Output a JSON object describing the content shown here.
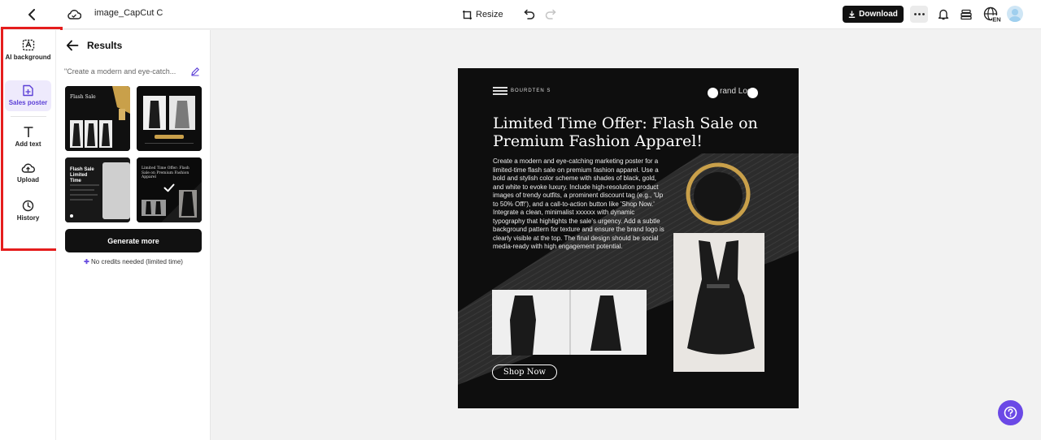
{
  "header": {
    "filename": "image_CapCut C",
    "resize_label": "Resize",
    "download_label": "Download"
  },
  "rail": {
    "items": [
      {
        "label": "AI background",
        "icon": "ai-background-icon"
      },
      {
        "label": "Sales poster",
        "icon": "sales-poster-icon"
      },
      {
        "label": "Add text",
        "icon": "text-icon"
      },
      {
        "label": "Upload",
        "icon": "upload-icon"
      },
      {
        "label": "History",
        "icon": "clock-icon"
      }
    ],
    "active": "Sales poster"
  },
  "results": {
    "title": "Results",
    "prompt": "\"Create a modern and eye-catch...",
    "thumbs": [
      {
        "title": "Flash Sale"
      },
      {
        "title": ""
      },
      {
        "title": "Flash Sale Limited Time"
      },
      {
        "title": "Limited Time Offer: Flash Sale on Premium Fashion Apparel"
      }
    ],
    "selected_index": 3,
    "generate_label": "Generate more",
    "credits_note": "No credits needed (limited time)"
  },
  "poster": {
    "brand": "BOURDTEN S",
    "brand_logo": "rand Log",
    "headline": "Limited Time Offer: Flash Sale on Premium Fashion Apparel!",
    "body": "Create a modern and eye-catching marketing poster for a limited-time flash sale on premium fashion apparel. Use a bold and stylish color scheme with shades of black, gold, and white to evoke luxury. Include high-resolution product images of trendy outfits, a prominent discount tag (e.g., 'Up to 50% Off!'), and a call-to-action button like 'Shop Now.' Integrate a clean, minimalist xxxxxx with dynamic typography that highlights the sale's urgency. Add a subtle background pattern for texture and ensure the brand logo is clearly visible at the top. The final design should be social media-ready with high engagement potential.",
    "cta": "Shop Now"
  },
  "colors": {
    "accent": "#6b49e6",
    "highlight": "#e51d1d",
    "dark": "#111111",
    "gold": "#c9a04a"
  }
}
